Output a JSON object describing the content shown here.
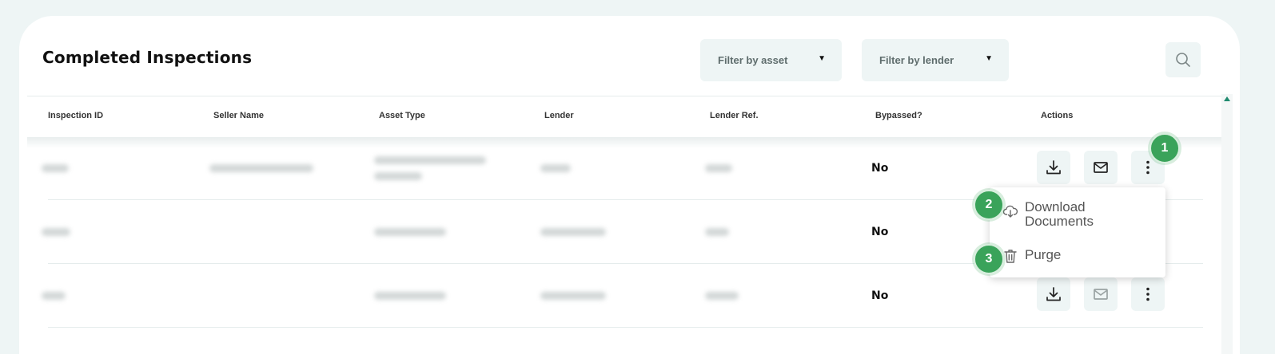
{
  "page": {
    "title": "Completed Inspections"
  },
  "filters": {
    "asset_label": "Filter by asset",
    "lender_label": "Filter by lender",
    "caret": "▼"
  },
  "table": {
    "headers": [
      "Inspection ID",
      "Seller Name",
      "Asset Type",
      "Lender",
      "Lender Ref.",
      "Bypassed?",
      "Actions"
    ],
    "rows": [
      {
        "bypassed": "No"
      },
      {
        "bypassed": "No"
      },
      {
        "bypassed": "No"
      }
    ]
  },
  "actions_menu": {
    "download_documents": "Download\nDocuments",
    "download_line1": "Download",
    "download_line2": "Documents",
    "purge": "Purge"
  },
  "badges": [
    "1",
    "2",
    "3"
  ],
  "icons": {
    "search": "search-icon",
    "download": "download-icon",
    "mail": "mail-icon",
    "more": "more-vertical-icon",
    "cloud_download": "cloud-download-icon",
    "trash": "trash-icon"
  },
  "colors": {
    "accent": "#3aa35a",
    "background": "#eef5f5",
    "scroll_accent": "#1f8a6e"
  }
}
